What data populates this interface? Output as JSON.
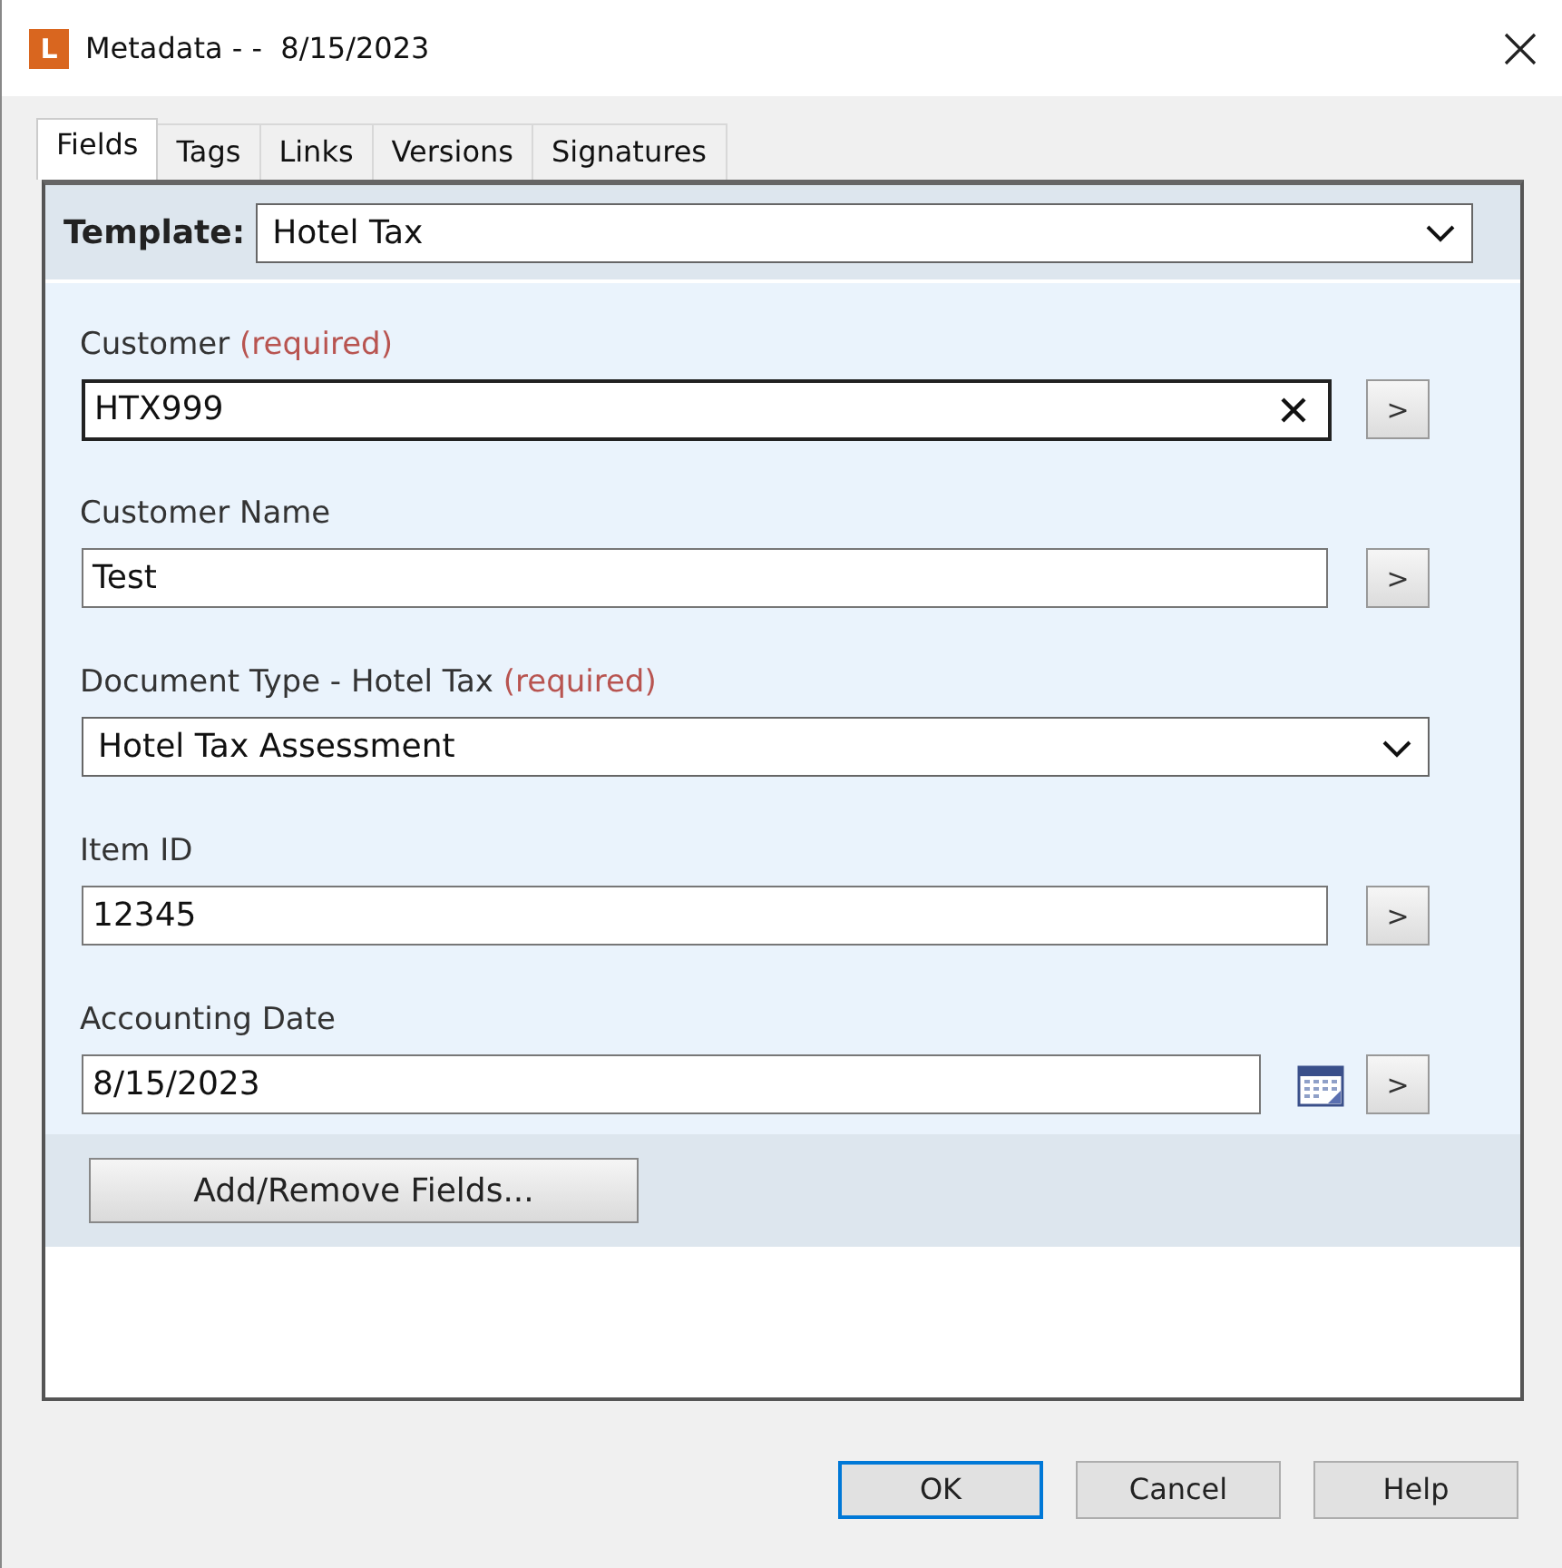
{
  "window": {
    "title": "Metadata - -  8/15/2023",
    "logo": "L"
  },
  "tabs": [
    {
      "label": "Fields",
      "selected": true
    },
    {
      "label": "Tags",
      "selected": false
    },
    {
      "label": "Links",
      "selected": false
    },
    {
      "label": "Versions",
      "selected": false
    },
    {
      "label": "Signatures",
      "selected": false
    }
  ],
  "template": {
    "label": "Template:",
    "value": "Hotel Tax"
  },
  "fields": [
    {
      "kind": "text",
      "label": "Customer",
      "required": "(required)",
      "value": "HTX999",
      "clearable": true,
      "browse": ">"
    },
    {
      "kind": "text",
      "label": "Customer Name",
      "value": "Test",
      "browse": ">"
    },
    {
      "kind": "dropdown",
      "label": "Document Type - Hotel Tax",
      "required": "(required)",
      "value": "Hotel Tax Assessment"
    },
    {
      "kind": "text",
      "label": "Item ID",
      "value": "12345",
      "browse": ">"
    },
    {
      "kind": "date",
      "label": "Accounting Date",
      "value": "8/15/2023",
      "browse": ">"
    }
  ],
  "add_remove_button": "Add/Remove Fields...",
  "buttons": [
    {
      "label": "OK",
      "default": true
    },
    {
      "label": "Cancel",
      "default": false
    },
    {
      "label": "Help",
      "default": false
    }
  ]
}
